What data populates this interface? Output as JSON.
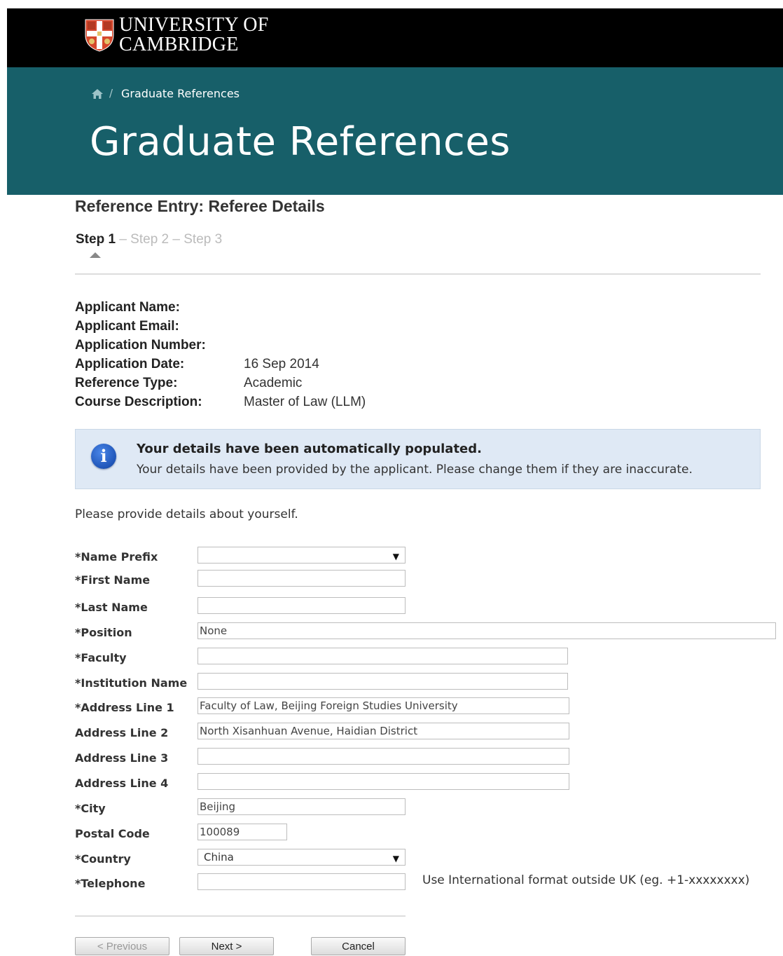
{
  "header": {
    "university_line1": "UNIVERSITY OF",
    "university_line2": "CAMBRIDGE",
    "breadcrumb_separator": "/",
    "breadcrumb_current": "Graduate References",
    "page_title": "Graduate References"
  },
  "section": {
    "title": "Reference Entry: Referee Details",
    "steps": [
      "Step 1",
      "Step 2",
      "Step 3"
    ],
    "step_separator": "–",
    "current_step": 1
  },
  "applicant_info": [
    {
      "label": "Applicant Name:",
      "value": ""
    },
    {
      "label": "Applicant Email:",
      "value": ""
    },
    {
      "label": "Application Number:",
      "value": ""
    },
    {
      "label": "Application Date:",
      "value": "16 Sep 2014"
    },
    {
      "label": "Reference Type:",
      "value": "Academic"
    },
    {
      "label": "Course Description:",
      "value": "Master of Law (LLM)"
    }
  ],
  "alert": {
    "icon": "info-icon",
    "title": "Your details have been automatically populated.",
    "text": "Your details have been provided by the applicant. Please change them if they are inaccurate."
  },
  "intro": "Please provide details about yourself.",
  "form": {
    "name_prefix": {
      "label": "*Name Prefix",
      "value": ""
    },
    "first_name": {
      "label": "*First Name",
      "value": ""
    },
    "last_name": {
      "label": "*Last Name",
      "value": ""
    },
    "position": {
      "label": "*Position",
      "value": "None"
    },
    "faculty": {
      "label": "*Faculty",
      "value": ""
    },
    "institution_name": {
      "label": "*Institution Name",
      "value": ""
    },
    "address_line_1": {
      "label": "*Address Line 1",
      "value": "Faculty of Law, Beijing Foreign Studies University"
    },
    "address_line_2": {
      "label": "Address Line 2",
      "value": "North Xisanhuan Avenue, Haidian District"
    },
    "address_line_3": {
      "label": "Address Line 3",
      "value": ""
    },
    "address_line_4": {
      "label": "Address Line 4",
      "value": ""
    },
    "city": {
      "label": "*City",
      "value": "Beijing"
    },
    "postal_code": {
      "label": "Postal Code",
      "value": "100089"
    },
    "country": {
      "label": "*Country",
      "value": "China"
    },
    "telephone": {
      "label": "*Telephone",
      "value": "",
      "hint": "Use International format outside UK (eg. +1-xxxxxxxx)"
    }
  },
  "buttons": {
    "previous": "< Previous",
    "next": "Next >",
    "cancel": "Cancel"
  },
  "colors": {
    "top_bar": "#000000",
    "hero_background": "#175f69",
    "alert_background": "#dfe9f5"
  }
}
